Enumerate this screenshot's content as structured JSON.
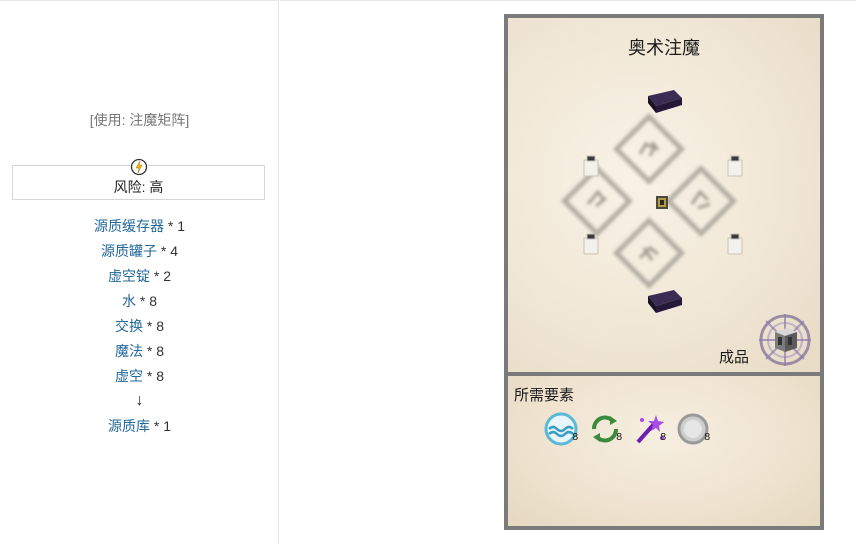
{
  "left": {
    "usage": "[使用: 注魔矩阵]",
    "risk_label": "风险: 高",
    "ingredients": [
      {
        "name": "源质缓存器",
        "qty": " * 1"
      },
      {
        "name": "源质罐子",
        "qty": " * 4"
      },
      {
        "name": "虚空锭",
        "qty": " * 2"
      },
      {
        "name": "水",
        "qty": " * 8"
      },
      {
        "name": "交换",
        "qty": " * 8"
      },
      {
        "name": "魔法",
        "qty": " * 8"
      },
      {
        "name": "虚空",
        "qty": " * 8"
      }
    ],
    "arrow": "↓",
    "result": {
      "name": "源质库",
      "qty": " * 1"
    }
  },
  "panel": {
    "title": "奥术注魔",
    "product_label": "成品",
    "requirements_title": "所需要素",
    "aspects": [
      {
        "icon": "water-aspect-icon",
        "count": "8",
        "color": "#5bb8d6"
      },
      {
        "icon": "exchange-aspect-icon",
        "count": "8",
        "color": "#3c8a3c"
      },
      {
        "icon": "magic-aspect-icon",
        "count": "8",
        "color": "#8a2be2"
      },
      {
        "icon": "void-aspect-icon",
        "count": "8",
        "color": "#9a9a9a"
      }
    ]
  }
}
